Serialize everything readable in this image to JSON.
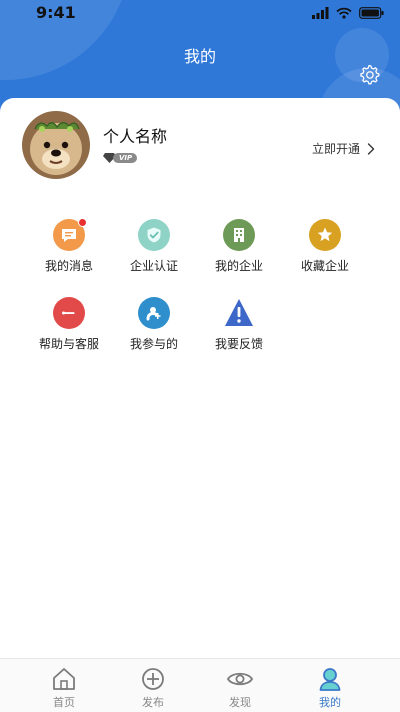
{
  "status_bar": {
    "time": "9:41"
  },
  "header": {
    "title": "我的"
  },
  "profile": {
    "name": "个人名称",
    "vip_label": "VIP",
    "open_link_label": "立即开通"
  },
  "menu": [
    {
      "label": "我的消息",
      "icon": "message-icon",
      "color": "#f2994a"
    },
    {
      "label": "企业认证",
      "icon": "shield-check-icon",
      "color": "#8fd3c7"
    },
    {
      "label": "我的企业",
      "icon": "building-icon",
      "color": "#6e9a57"
    },
    {
      "label": "收藏企业",
      "icon": "star-icon",
      "color": "#d9a121"
    },
    {
      "label": "帮助与客服",
      "icon": "help-minus-icon",
      "color": "#e24a4a"
    },
    {
      "label": "我参与的",
      "icon": "person-plus-icon",
      "color": "#2f8fcd"
    },
    {
      "label": "我要反馈",
      "icon": "warning-triangle-icon",
      "color": "#3d67c8"
    }
  ],
  "tabs": [
    {
      "label": "首页",
      "icon": "home-icon"
    },
    {
      "label": "发布",
      "icon": "plus-circle-icon"
    },
    {
      "label": "发现",
      "icon": "eye-icon"
    },
    {
      "label": "我的",
      "icon": "profile-icon",
      "active": true
    }
  ],
  "colors": {
    "header": "#2f78d8",
    "active_tab": "#3b79c8"
  }
}
